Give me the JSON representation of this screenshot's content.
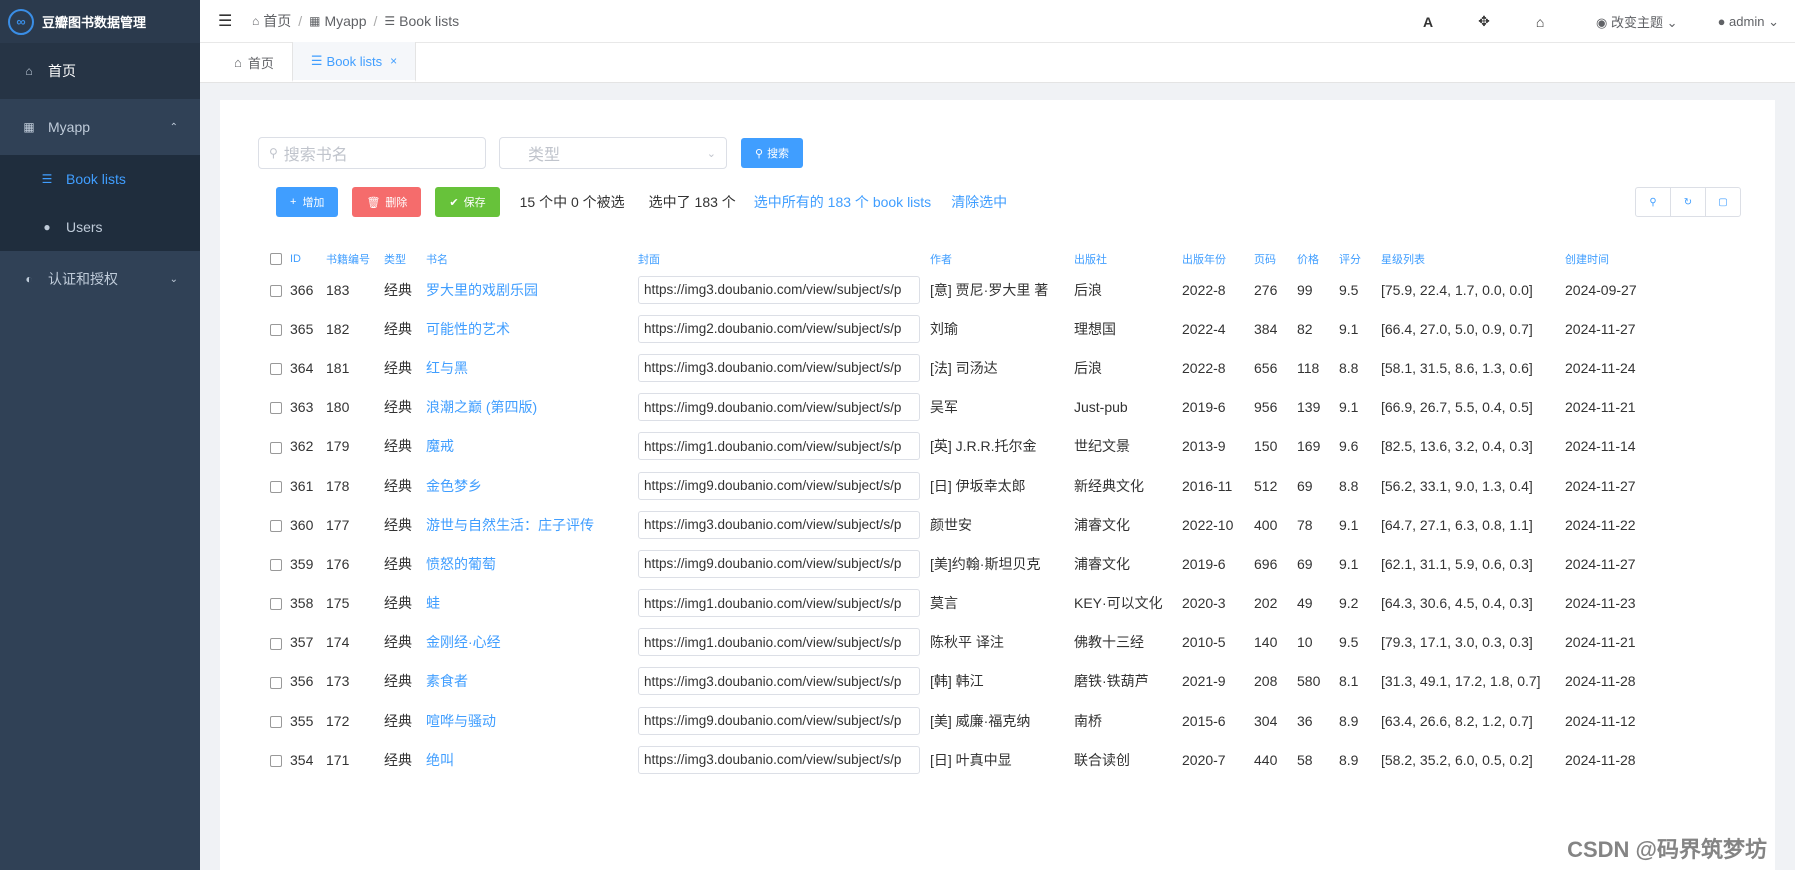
{
  "app": {
    "title": "豆瓣图书数据管理",
    "logo_glyph": "∞"
  },
  "sidebar": {
    "home": "首页",
    "myapp": "Myapp",
    "myapp_items": [
      {
        "label": "Book lists"
      },
      {
        "label": "Users"
      }
    ],
    "auth": "认证和授权"
  },
  "breadcrumb": [
    "首页",
    "Myapp",
    "Book lists"
  ],
  "navbar": {
    "font_icon": "A",
    "theme": "改变主题",
    "user": "admin"
  },
  "tags": [
    {
      "label": "首页"
    },
    {
      "label": "Book lists"
    }
  ],
  "filters": {
    "search_placeholder": "搜索书名",
    "type_placeholder": "类型",
    "search_btn": "搜索"
  },
  "actions": {
    "add": "增加",
    "delete": "删除",
    "save": "保存",
    "selection": "15 个中 0 个被选",
    "selected": "选中了 183 个",
    "select_all": "选中所有的 183 个 book lists",
    "clear": "清除选中"
  },
  "table": {
    "columns": [
      "ID",
      "书籍编号",
      "类型",
      "书名",
      "封面",
      "作者",
      "出版社",
      "出版年份",
      "页码",
      "价格",
      "评分",
      "星级列表",
      "创建时间"
    ],
    "rows": [
      [
        "366",
        "183",
        "经典",
        "罗大里的戏剧乐园",
        "https://img3.doubanio.com/view/subject/s/p",
        "[意] 贾尼·罗大里 著",
        "后浪",
        "2022-8",
        "276",
        "99",
        "9.5",
        "[75.9, 22.4, 1.7, 0.0, 0.0]",
        "2024-09-27"
      ],
      [
        "365",
        "182",
        "经典",
        "可能性的艺术",
        "https://img2.doubanio.com/view/subject/s/p",
        "刘瑜",
        "理想国",
        "2022-4",
        "384",
        "82",
        "9.1",
        "[66.4, 27.0, 5.0, 0.9, 0.7]",
        "2024-11-27"
      ],
      [
        "364",
        "181",
        "经典",
        "红与黑",
        "https://img3.doubanio.com/view/subject/s/p",
        "[法] 司汤达",
        "后浪",
        "2022-8",
        "656",
        "118",
        "8.8",
        "[58.1, 31.5, 8.6, 1.3, 0.6]",
        "2024-11-24"
      ],
      [
        "363",
        "180",
        "经典",
        "浪潮之巅 (第四版)",
        "https://img9.doubanio.com/view/subject/s/p",
        "吴军",
        "Just-pub",
        "2019-6",
        "956",
        "139",
        "9.1",
        "[66.9, 26.7, 5.5, 0.4, 0.5]",
        "2024-11-21"
      ],
      [
        "362",
        "179",
        "经典",
        "魔戒",
        "https://img1.doubanio.com/view/subject/s/p",
        "[英] J.R.R.托尔金",
        "世纪文景",
        "2013-9",
        "150",
        "169",
        "9.6",
        "[82.5, 13.6, 3.2, 0.4, 0.3]",
        "2024-11-14"
      ],
      [
        "361",
        "178",
        "经典",
        "金色梦乡",
        "https://img9.doubanio.com/view/subject/s/p",
        "[日] 伊坂幸太郎",
        "新经典文化",
        "2016-11",
        "512",
        "69",
        "8.8",
        "[56.2, 33.1, 9.0, 1.3, 0.4]",
        "2024-11-27"
      ],
      [
        "360",
        "177",
        "经典",
        "游世与自然生活：庄子评传",
        "https://img3.doubanio.com/view/subject/s/p",
        "颜世安",
        "浦睿文化",
        "2022-10",
        "400",
        "78",
        "9.1",
        "[64.7, 27.1, 6.3, 0.8, 1.1]",
        "2024-11-22"
      ],
      [
        "359",
        "176",
        "经典",
        "愤怒的葡萄",
        "https://img9.doubanio.com/view/subject/s/p",
        "[美]约翰·斯坦贝克",
        "浦睿文化",
        "2019-6",
        "696",
        "69",
        "9.1",
        "[62.1, 31.1, 5.9, 0.6, 0.3]",
        "2024-11-27"
      ],
      [
        "358",
        "175",
        "经典",
        "蛙",
        "https://img1.doubanio.com/view/subject/s/p",
        "莫言",
        "KEY·可以文化",
        "2020-3",
        "202",
        "49",
        "9.2",
        "[64.3, 30.6, 4.5, 0.4, 0.3]",
        "2024-11-23"
      ],
      [
        "357",
        "174",
        "经典",
        "金刚经·心经",
        "https://img1.doubanio.com/view/subject/s/p",
        "陈秋平 译注",
        "佛教十三经",
        "2010-5",
        "140",
        "10",
        "9.5",
        "[79.3, 17.1, 3.0, 0.3, 0.3]",
        "2024-11-21"
      ],
      [
        "356",
        "173",
        "经典",
        "素食者",
        "https://img3.doubanio.com/view/subject/s/p",
        "[韩] 韩江",
        "磨铁·铁葫芦",
        "2021-9",
        "208",
        "580",
        "8.1",
        "[31.3, 49.1, 17.2, 1.8, 0.7]",
        "2024-11-28"
      ],
      [
        "355",
        "172",
        "经典",
        "喧哗与骚动",
        "https://img9.doubanio.com/view/subject/s/p",
        "[美] 威廉·福克纳",
        "南桥",
        "2015-6",
        "304",
        "36",
        "8.9",
        "[63.4, 26.6, 8.2, 1.2, 0.7]",
        "2024-11-12"
      ],
      [
        "354",
        "171",
        "经典",
        "绝叫",
        "https://img3.doubanio.com/view/subject/s/p",
        "[日] 叶真中显",
        "联合读创",
        "2020-7",
        "440",
        "58",
        "8.9",
        "[58.2, 35.2, 6.0, 0.5, 0.2]",
        "2024-11-28"
      ]
    ]
  },
  "watermark": "CSDN @码界筑梦坊"
}
